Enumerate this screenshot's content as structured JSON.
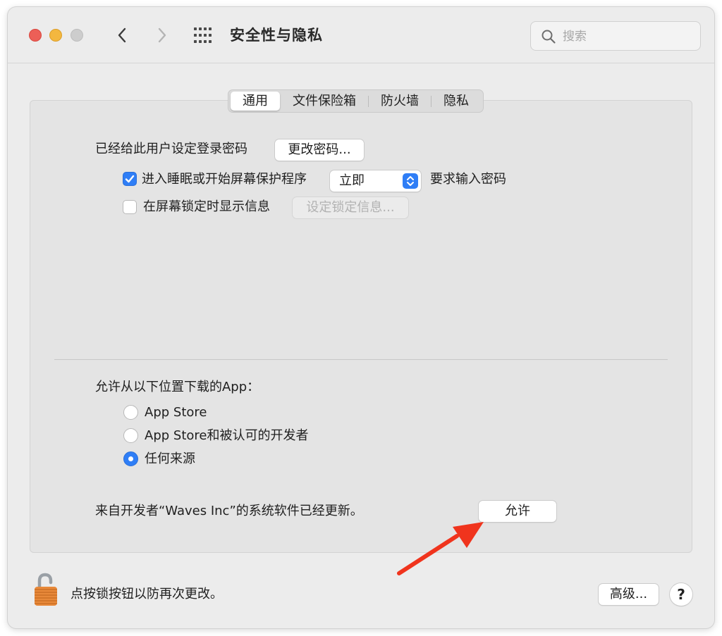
{
  "window": {
    "title": "安全性与隐私"
  },
  "search": {
    "placeholder": "搜索",
    "icon": "search-icon"
  },
  "tabs": [
    {
      "label": "通用",
      "selected": true
    },
    {
      "label": "文件保险箱",
      "selected": false
    },
    {
      "label": "防火墙",
      "selected": false
    },
    {
      "label": "隐私",
      "selected": false
    }
  ],
  "general": {
    "password_label": "已经给此用户设定登录密码",
    "change_password_button": "更改密码...",
    "require_password": {
      "label": "进入睡眠或开始屏幕保护程序",
      "checked": true,
      "select_value": "立即",
      "suffix": "要求输入密码"
    },
    "lock_message": {
      "label": "在屏幕锁定时显示信息",
      "checked": false,
      "button": "设定锁定信息..."
    }
  },
  "downloads": {
    "heading": "允许从以下位置下载的App：",
    "options": [
      {
        "label": "App Store",
        "selected": false
      },
      {
        "label": "App Store和被认可的开发者",
        "selected": false
      },
      {
        "label": "任何来源",
        "selected": true
      }
    ]
  },
  "notice": {
    "text": "来自开发者“Waves Inc”的系统软件已经更新。",
    "allow_button": "允许"
  },
  "footer": {
    "lock_text": "点按锁按钮以防再次更改。",
    "advanced_button": "高级...",
    "help_button": "?"
  },
  "colors": {
    "accent": "#2f7ef6",
    "annotation_arrow": "#f0341d"
  }
}
